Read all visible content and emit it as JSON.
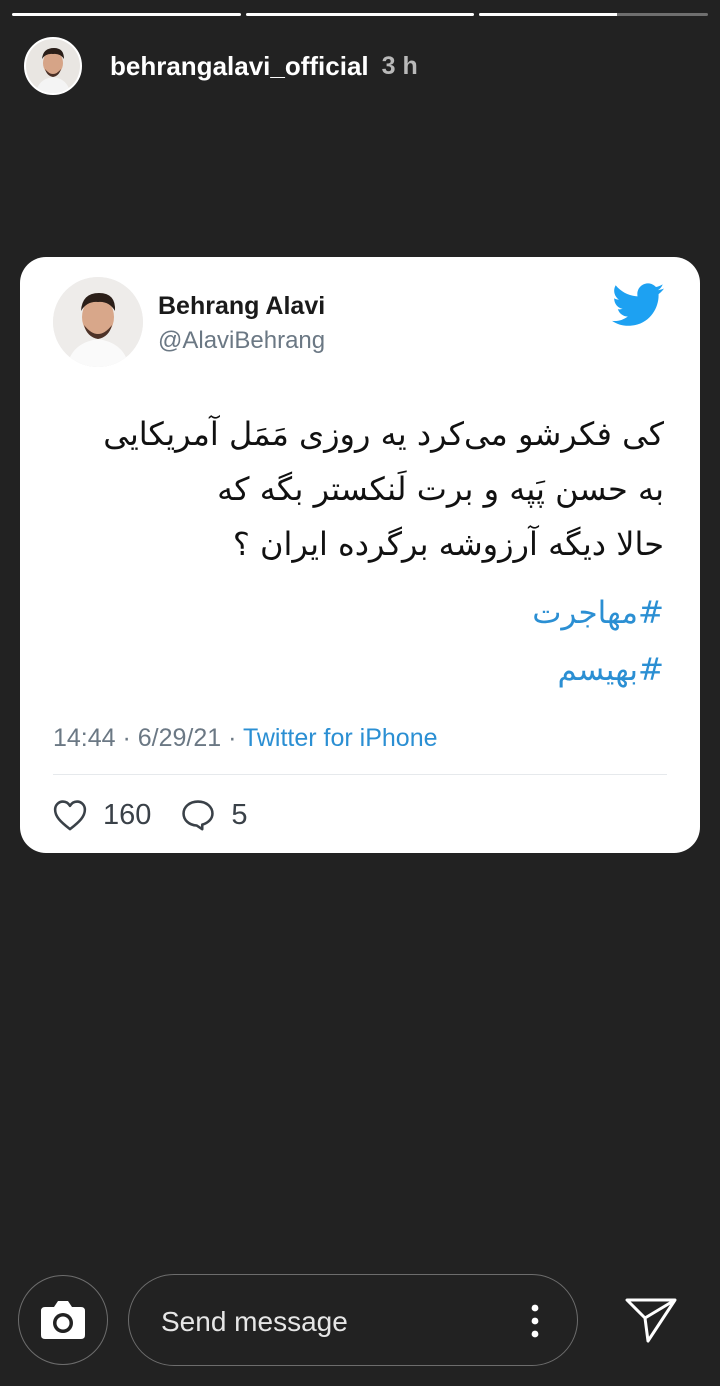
{
  "story": {
    "progress": [
      1,
      1,
      0.6
    ],
    "username": "behrangalavi_official",
    "time": "3 h"
  },
  "tweet": {
    "name": "Behrang Alavi",
    "handle": "@AlaviBehrang",
    "lines": [
      "کی فکرشو می‌کرد یه روزی مَمَل آمریکایی",
      "به حسن پَپه و برت لَنکستر بگه که",
      "حالا دیگه آرزوشه برگرده ایران ؟"
    ],
    "hashtags": [
      "#مهاجرت",
      "#بهیسم"
    ],
    "time": "14:44 · 6/29/21 · ",
    "source": "Twitter for iPhone",
    "likes": "160",
    "replies": "5",
    "icons": {
      "logo": "twitter-bird-icon",
      "like": "heart-icon",
      "reply": "speech-bubble-icon"
    },
    "colors": {
      "link": "#2b8fd3",
      "brand": "#1da1f2"
    }
  },
  "composer": {
    "placeholder": "Send message",
    "icons": {
      "camera": "camera-icon",
      "more": "more-vertical-icon",
      "send": "send-icon"
    }
  }
}
